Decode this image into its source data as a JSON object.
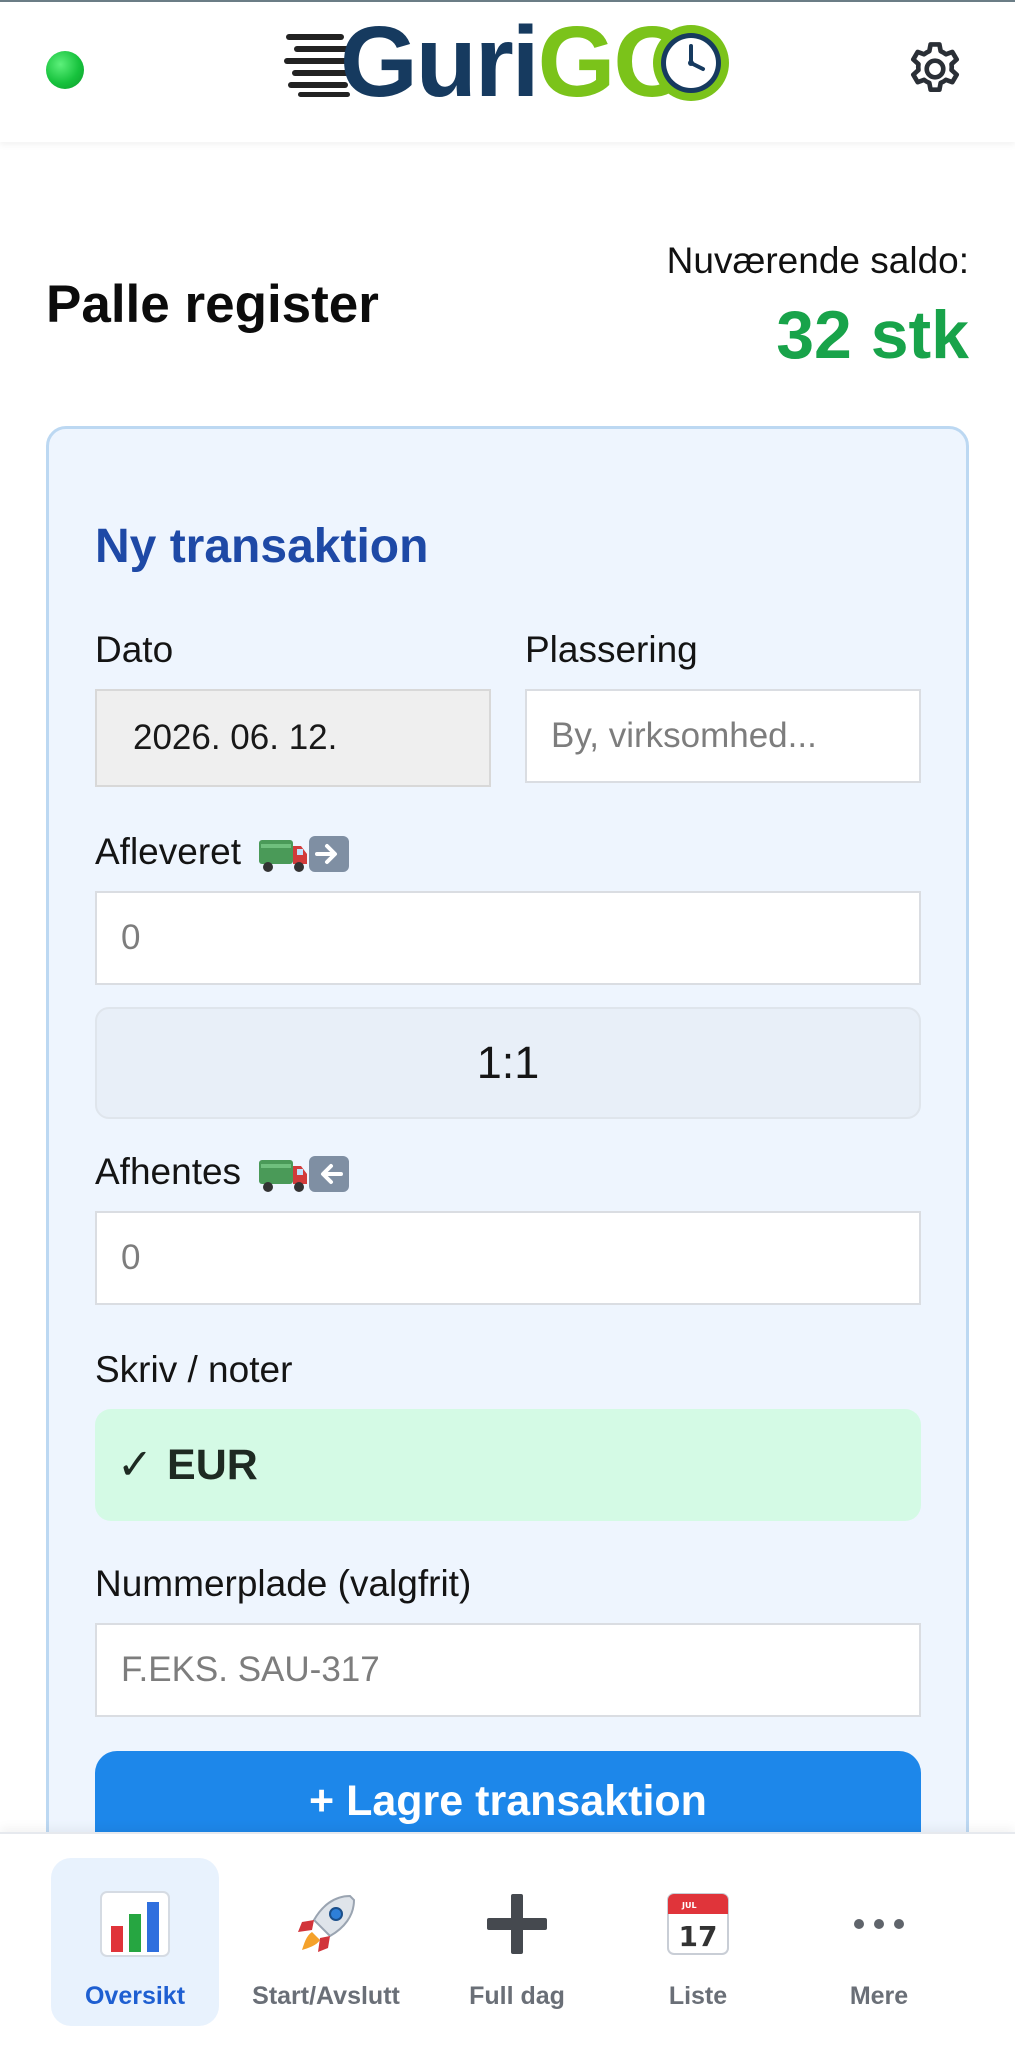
{
  "header": {
    "logo_text_primary": "Guri",
    "logo_text_accent": "GO",
    "status_color": "#22c55e",
    "icons": [
      "status-dot",
      "gear-icon"
    ]
  },
  "page": {
    "title": "Palle register",
    "balance_label": "Nuværende saldo:",
    "balance_value": "32 stk",
    "balance_color": "#18a34a"
  },
  "form": {
    "title": "Ny transaktion",
    "date_label": "Dato",
    "date_value": "2026. 06. 12.",
    "location_label": "Plassering",
    "location_placeholder": "By, virksomhed...",
    "delivered_label": "Afleveret",
    "delivered_placeholder": "0",
    "ratio_label": "1:1",
    "pickup_label": "Afhentes",
    "pickup_placeholder": "0",
    "note_label": "Skriv / noter",
    "note_selected": "EUR",
    "note_check": "✓",
    "plate_label": "Nummerplade (valgfrit)",
    "plate_placeholder": "F.EKS. SAU-317",
    "save_button": "+ Lagre transaktion"
  },
  "bottom_nav": {
    "items": [
      {
        "label": "Oversikt",
        "icon": "bar-chart-icon",
        "active": true
      },
      {
        "label": "Start/Avslutt",
        "icon": "rocket-icon",
        "active": false
      },
      {
        "label": "Full dag",
        "icon": "plus-icon",
        "active": false
      },
      {
        "label": "Liste",
        "icon": "calendar-icon",
        "active": false
      },
      {
        "label": "Mere",
        "icon": "more-icon",
        "active": false
      }
    ]
  },
  "colors": {
    "accent_blue": "#1d87ea",
    "title_blue": "#1e49a6",
    "card_bg": "#eef5fe",
    "chip_green_bg": "#d4fae5"
  }
}
